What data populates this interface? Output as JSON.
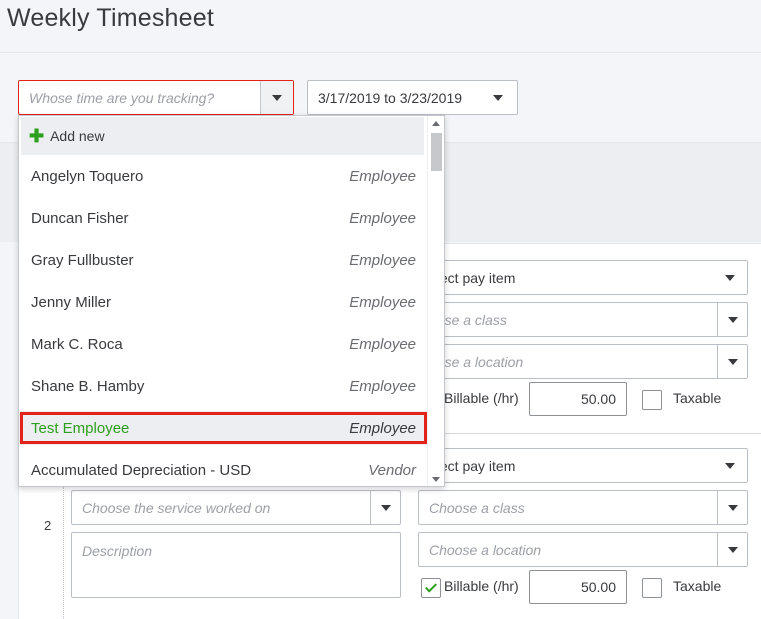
{
  "page": {
    "title": "Weekly Timesheet"
  },
  "filters": {
    "name_placeholder": "Whose time are you tracking?",
    "date_range": "3/17/2019 to 3/23/2019"
  },
  "dropdown": {
    "add_new": "Add new",
    "items": [
      {
        "name": "Angelyn Toquero",
        "type": "Employee"
      },
      {
        "name": "Duncan Fisher",
        "type": "Employee"
      },
      {
        "name": "Gray Fullbuster",
        "type": "Employee"
      },
      {
        "name": "Jenny Miller",
        "type": "Employee"
      },
      {
        "name": "Mark C. Roca",
        "type": "Employee"
      },
      {
        "name": "Shane B. Hamby",
        "type": "Employee"
      },
      {
        "name": "Test Employee",
        "type": "Employee"
      },
      {
        "name": "Accumulated Depreciation - USD",
        "type": "Vendor"
      }
    ]
  },
  "rows": [
    {
      "pay_item": "elect pay item",
      "class_placeholder": "oose a class",
      "location_placeholder": "oose a location",
      "billable_label": "Billable (/hr)",
      "rate": "50.00",
      "taxable_label": "Taxable"
    },
    {
      "number": "2",
      "service_placeholder": "Choose the service worked on",
      "description_placeholder": "Description",
      "pay_item": "elect pay item",
      "class_placeholder": "Choose a class",
      "location_placeholder": "Choose a location",
      "billable_label": "Billable (/hr)",
      "billable_checked": true,
      "rate": "50.00",
      "taxable_label": "Taxable"
    }
  ],
  "colors": {
    "accent_green": "#2ca01c",
    "highlight_red": "#e2231a"
  }
}
